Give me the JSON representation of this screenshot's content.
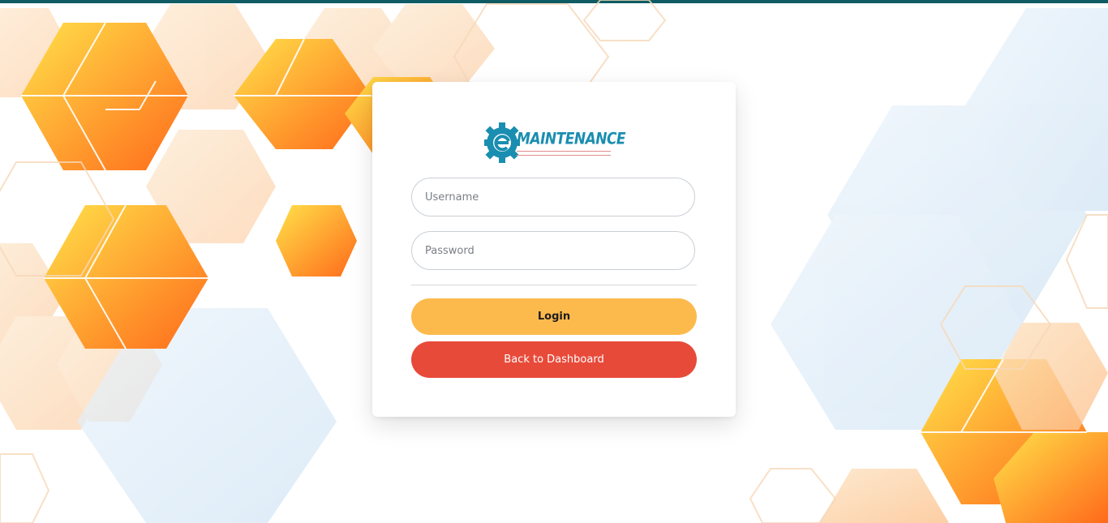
{
  "brand": {
    "logo_text": "MAINTENANCE",
    "primary_color": "#1a8eb0"
  },
  "login_form": {
    "username_placeholder": "Username",
    "password_placeholder": "Password",
    "login_label": "Login",
    "back_label": "Back to Dashboard"
  },
  "colors": {
    "top_bar": "#0e5b63",
    "login_button": "#fdba4c",
    "back_button": "#e84a3a",
    "hex_orange": "#ff7a1f",
    "hex_yellow": "#ffe24a",
    "hex_blue": "#d7e8f6"
  }
}
